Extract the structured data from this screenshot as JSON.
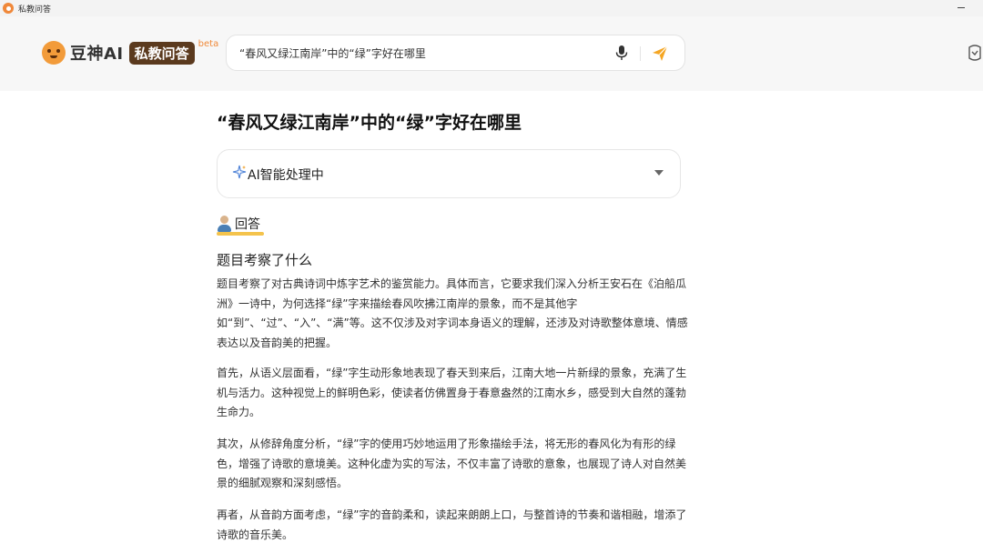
{
  "window": {
    "title": "私教问答"
  },
  "brand": {
    "name": "豆神AI",
    "badge": "私教问答",
    "beta": "beta"
  },
  "search": {
    "value": "“春风又绿江南岸”中的“绿”字好在哪里"
  },
  "question": {
    "title": "“春风又绿江南岸”中的“绿”字好在哪里"
  },
  "ai_status": {
    "label": "AI智能处理中"
  },
  "answer": {
    "label": "回答",
    "heading": "题目考察了什么",
    "paragraphs": [
      "题目考察了对古典诗词中炼字艺术的鉴赏能力。具体而言，它要求我们深入分析王安石在《泊船瓜洲》一诗中，为何选择“绿”字来描绘春风吹拂江南岸的景象，而不是其他字如“到”、“过”、“入”、“满”等。这不仅涉及对字词本身语义的理解，还涉及对诗歌整体意境、情感表达以及音韵美的把握。",
      "首先，从语义层面看，“绿”字生动形象地表现了春天到来后，江南大地一片新绿的景象，充满了生机与活力。这种视觉上的鲜明色彩，使读者仿佛置身于春意盎然的江南水乡，感受到大自然的蓬勃生命力。",
      "其次，从修辞角度分析，“绿”字的使用巧妙地运用了形象描绘手法，将无形的春风化为有形的绿色，增强了诗歌的意境美。这种化虚为实的写法，不仅丰富了诗歌的意象，也展现了诗人对自然美景的细腻观察和深刻感悟。",
      "再者，从音韵方面考虑，“绿”字的音韵柔和，读起来朗朗上口，与整首诗的节奏和谐相融，增添了诗歌的音乐美。"
    ]
  },
  "icons": {
    "app": "app-icon",
    "minimize": "minimize-icon",
    "mic": "microphone-icon",
    "send": "send-icon",
    "sparkle": "sparkle-icon",
    "chevron": "chevron-down-icon",
    "avatar": "teacher-avatar",
    "header_right": "user-icon"
  },
  "colors": {
    "accent": "#f08a3a",
    "badge_bg": "#5b3a1e",
    "underline": "#f4c34c"
  }
}
